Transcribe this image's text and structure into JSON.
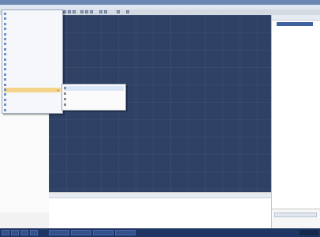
{
  "window": {
    "title": ""
  },
  "menubar": {
    "items": [
      "",
      "",
      "",
      "",
      "",
      "",
      "",
      ""
    ]
  },
  "left_panel": {
    "items": []
  },
  "menu": {
    "items": [
      {
        "label": "",
        "highlight": false
      },
      {
        "label": "",
        "highlight": false
      },
      {
        "label": "",
        "highlight": false
      },
      {
        "label": "",
        "highlight": false
      },
      {
        "label": "",
        "highlight": false
      },
      {
        "label": "",
        "highlight": false
      },
      {
        "label": "",
        "highlight": false
      },
      {
        "label": "",
        "highlight": false
      },
      {
        "label": "",
        "highlight": false
      },
      {
        "label": "",
        "highlight": false
      },
      {
        "label": "",
        "highlight": false
      },
      {
        "label": "",
        "highlight": false
      },
      {
        "label": "",
        "highlight": false
      },
      {
        "label": "",
        "highlight": false
      },
      {
        "label": "",
        "highlight": false
      },
      {
        "label": "",
        "highlight": true
      },
      {
        "label": "",
        "highlight": false
      },
      {
        "label": "",
        "highlight": false
      },
      {
        "label": "",
        "highlight": false
      },
      {
        "label": "",
        "highlight": false
      }
    ]
  },
  "submenu": {
    "items": [
      {
        "label": "",
        "highlight": true
      },
      {
        "label": "",
        "highlight": false
      },
      {
        "label": "",
        "highlight": false
      },
      {
        "label": "",
        "highlight": false
      }
    ]
  },
  "right_panel": {
    "title": "",
    "tree_item": ""
  },
  "output_panel": {
    "title": "",
    "tab": ""
  },
  "taskbar": {
    "items": [
      "",
      "",
      "",
      "",
      "",
      "",
      "",
      ""
    ],
    "clock": ""
  },
  "colors": {
    "workspace": "#2f4266",
    "titlebar": "#6b86b2",
    "taskbar": "#1f3563",
    "menu_highlight": "#f4d48b"
  }
}
